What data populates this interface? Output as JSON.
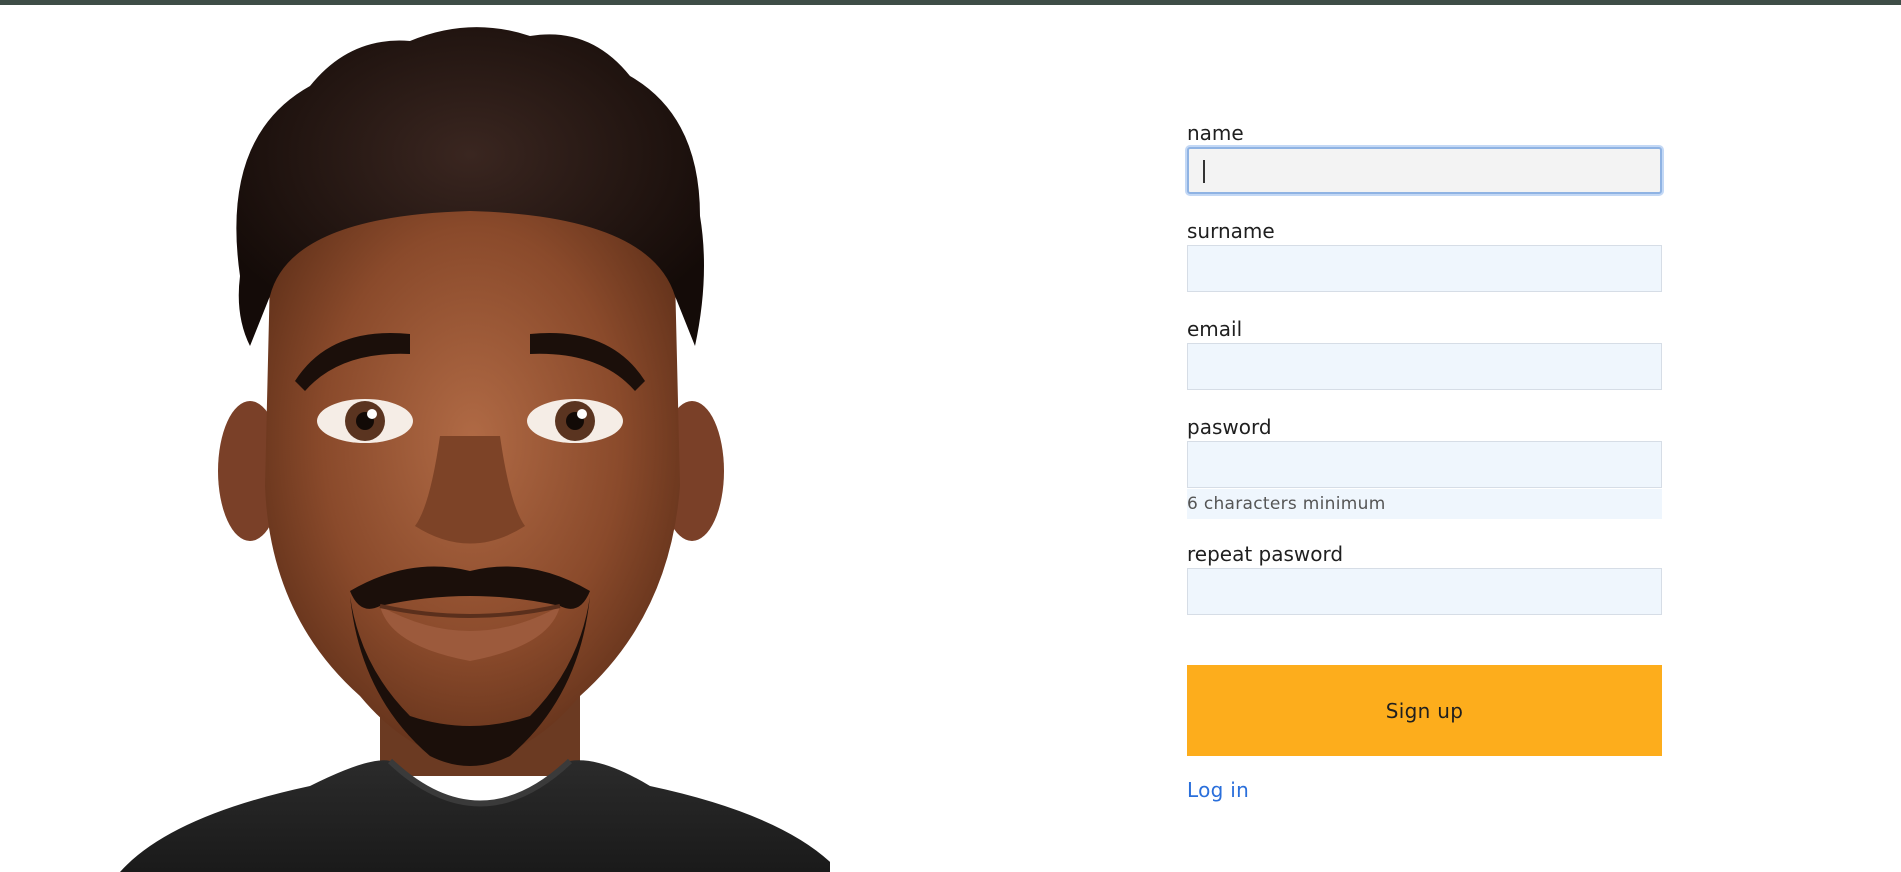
{
  "avatar": {
    "alt": "cartoon man avatar"
  },
  "form": {
    "fields": [
      {
        "label": "name",
        "value": "",
        "focused": true
      },
      {
        "label": "surname",
        "value": ""
      },
      {
        "label": "email",
        "value": ""
      },
      {
        "label": "pasword",
        "value": "",
        "hint": "6 characters minimum"
      },
      {
        "label": "repeat pasword",
        "value": ""
      }
    ],
    "submit_label": "Sign up",
    "login_link": "Log in"
  },
  "colors": {
    "top_bar": "#3e4d47",
    "input_bg": "#eff6fd",
    "button": "#fdad1c",
    "link": "#2a6fdb"
  }
}
